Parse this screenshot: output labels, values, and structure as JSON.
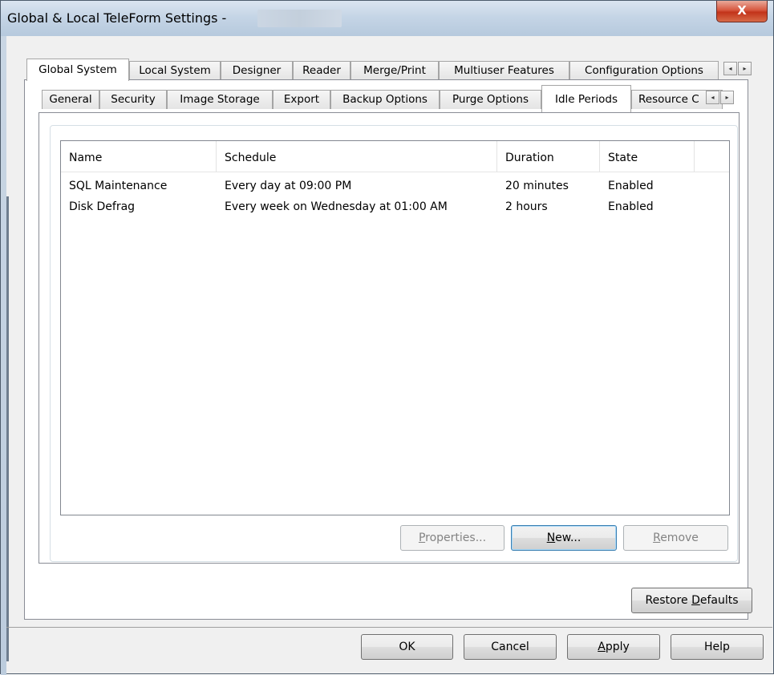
{
  "window": {
    "title": "Global & Local TeleForm Settings -",
    "close_glyph": "X"
  },
  "tabs_top": [
    {
      "label": "Global System",
      "active": true
    },
    {
      "label": "Local System",
      "active": false
    },
    {
      "label": "Designer",
      "active": false
    },
    {
      "label": "Reader",
      "active": false
    },
    {
      "label": "Merge/Print",
      "active": false
    },
    {
      "label": "Multiuser Features",
      "active": false
    },
    {
      "label": "Configuration Options",
      "active": false
    }
  ],
  "tabs_sub": [
    {
      "label": "General",
      "active": false
    },
    {
      "label": "Security",
      "active": false
    },
    {
      "label": "Image Storage",
      "active": false
    },
    {
      "label": "Export",
      "active": false
    },
    {
      "label": "Backup Options",
      "active": false
    },
    {
      "label": "Purge Options",
      "active": false
    },
    {
      "label": "Idle Periods",
      "active": true
    },
    {
      "label": "Resource C",
      "active": false
    }
  ],
  "scroll_arrows": {
    "left": "◂",
    "right": "▸"
  },
  "list": {
    "columns": [
      "Name",
      "Schedule",
      "Duration",
      "State"
    ],
    "rows": [
      [
        "SQL Maintenance",
        "Every day at 09:00 PM",
        "20 minutes",
        "Enabled"
      ],
      [
        "Disk Defrag",
        "Every week on Wednesday at 01:00 AM",
        "2 hours",
        "Enabled"
      ]
    ]
  },
  "list_buttons": {
    "properties": {
      "pre": "",
      "u": "P",
      "post": "roperties..."
    },
    "new": {
      "pre": "",
      "u": "N",
      "post": "ew..."
    },
    "remove": {
      "pre": "",
      "u": "R",
      "post": "emove"
    }
  },
  "restore_defaults": {
    "pre": "Restore ",
    "u": "D",
    "post": "efaults"
  },
  "dialog_buttons": {
    "ok": "OK",
    "cancel": "Cancel",
    "apply": {
      "pre": "",
      "u": "A",
      "post": "pply"
    },
    "help": "Help"
  }
}
